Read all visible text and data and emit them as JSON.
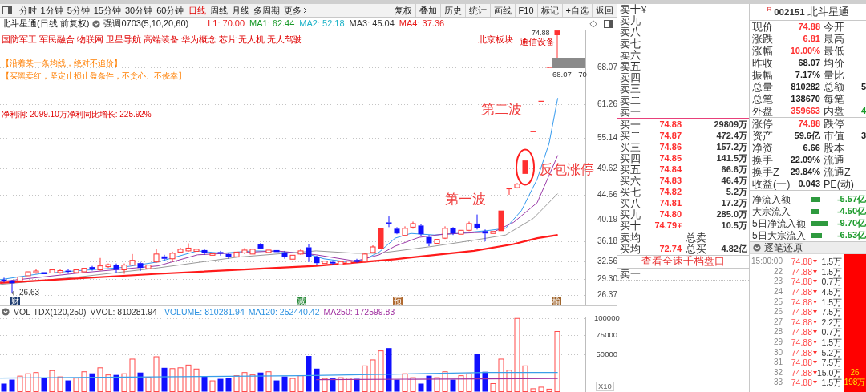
{
  "toolbar": {
    "period_tabs": [
      {
        "label": "分时",
        "kind": "period",
        "selected": false
      },
      {
        "label": "1分钟",
        "kind": "period",
        "selected": false
      },
      {
        "label": "5分钟",
        "kind": "period",
        "selected": false
      },
      {
        "label": "15分钟",
        "kind": "period",
        "selected": false
      },
      {
        "label": "30分钟",
        "kind": "period",
        "selected": false
      },
      {
        "label": "60分钟",
        "kind": "period",
        "selected": false
      },
      {
        "label": "日线",
        "kind": "period",
        "selected": true
      },
      {
        "label": "周线",
        "kind": "period",
        "selected": false
      },
      {
        "label": "月线",
        "kind": "period",
        "selected": false
      },
      {
        "label": "多周期",
        "kind": "period",
        "selected": false
      },
      {
        "label": "更多",
        "kind": "menu",
        "selected": false
      }
    ],
    "buttons": [
      "复权",
      "叠加",
      "历史",
      "统计",
      "画线",
      "F10",
      "标记",
      "+自选",
      "返回"
    ]
  },
  "chart": {
    "title": "北斗星通(日线 前复权)",
    "indicator": "强调0703(5,10,20,60)",
    "legend": [
      {
        "text": "L1: 70.00",
        "color": "#e81c1c"
      },
      {
        "text": "MA1: 62.44",
        "color": "#1a9a2a"
      },
      {
        "text": "MA2: 52.18",
        "color": "#20b4c8"
      },
      {
        "text": "MA3: 45.04",
        "color": "#333333"
      },
      {
        "text": "MA4: 37.36",
        "color": "#e81c1c"
      }
    ],
    "price_marker": "74.88",
    "concepts": "国防军工 军民融合 物联网 卫星导航 高端装备 华为概念 芯片 无人机 无人驾驶",
    "sector_tags": [
      "北京板块",
      "通信设备"
    ],
    "notes": [
      "【沿着某一条均线，绝对不追价】",
      "【买黑卖红；坚定止损止盈条件，不贪心、不侥幸】"
    ],
    "range_label": "68.07 - 70",
    "profit_note": "净利润: 2099.10万净利同比增长: 225.92%",
    "annotations": [
      "第二波",
      "反包涨停",
      "第一波"
    ],
    "low_label": "26.63",
    "y_axis": [
      "68.07",
      "61.26",
      "55.14",
      "49.62",
      "44.66",
      "40.19",
      "36.18",
      "32.56",
      "29.30",
      "26.37"
    ],
    "event_markers": [
      {
        "label": "财",
        "color": "#1f3d70"
      },
      {
        "label": "减",
        "color": "#2a8a3a"
      },
      {
        "label": "预",
        "color": "#b06a30"
      },
      {
        "label": "榆",
        "color": "#a0662e"
      }
    ]
  },
  "volume": {
    "title": "VOL-TDX(120,250)",
    "legend": [
      {
        "text": "VVOL: 810281.94",
        "color": "#333333"
      },
      {
        "text": "VOLUME: 810281.94",
        "color": "#2a90e0"
      },
      {
        "text": "MA120: 252440.42",
        "color": "#2a90e0"
      },
      {
        "text": "MA250: 172599.83",
        "color": "#a030a0"
      }
    ],
    "y_axis": [
      "100000",
      "75000",
      "50000"
    ],
    "scale_label": "X10"
  },
  "order_book": {
    "asks": [
      {
        "label": "卖十",
        "symbol": "¥"
      },
      {
        "label": "卖九"
      },
      {
        "label": "卖八"
      },
      {
        "label": "卖七"
      },
      {
        "label": "卖六"
      },
      {
        "label": "卖五"
      },
      {
        "label": "卖四"
      },
      {
        "label": "卖三"
      },
      {
        "label": "卖二"
      },
      {
        "label": "卖一"
      }
    ],
    "bids": [
      {
        "label": "买一",
        "price": "74.88",
        "volume": "29809万",
        "flag": false
      },
      {
        "label": "买二",
        "price": "74.87",
        "volume": "472.4万",
        "flag": false
      },
      {
        "label": "买三",
        "price": "74.86",
        "volume": "157.2万",
        "flag": false
      },
      {
        "label": "买四",
        "price": "74.85",
        "volume": "141.5万",
        "flag": false
      },
      {
        "label": "买五",
        "price": "74.84",
        "volume": "66.6万",
        "flag": false
      },
      {
        "label": "买六",
        "price": "74.83",
        "volume": "46.4万",
        "flag": false
      },
      {
        "label": "买七",
        "price": "74.82",
        "volume": "5.2万",
        "flag": false
      },
      {
        "label": "买八",
        "price": "74.81",
        "volume": "17.2万",
        "flag": false
      },
      {
        "label": "买九",
        "price": "74.80",
        "volume": "285.0万",
        "flag": false
      },
      {
        "label": "买十",
        "price": "74.79",
        "volume": "10.5万",
        "flag": true
      }
    ],
    "summary": [
      {
        "label": "卖均",
        "label2": "总卖"
      },
      {
        "label": "买均",
        "value": "72.74",
        "label2": "总买",
        "value2": "4.82亿"
      }
    ],
    "link": "查看全速千档盘口",
    "lower_asks": [
      "卖一"
    ]
  },
  "quote": {
    "badge": "R",
    "code": "002151",
    "name": "北斗星通",
    "rows": [
      {
        "cells": [
          {
            "label": "现价",
            "value": "74.88",
            "color": "#ff3030"
          },
          {
            "label": "今开"
          }
        ]
      },
      {
        "cells": [
          {
            "label": "涨跌",
            "value": "6.81",
            "color": "#ff3030"
          },
          {
            "label": "最高"
          }
        ]
      },
      {
        "cells": [
          {
            "label": "涨幅",
            "value": "10.00%",
            "color": "#ff3030"
          },
          {
            "label": "最低"
          }
        ]
      },
      {
        "cells": [
          {
            "label": "昨收",
            "value": "68.07",
            "color": "#222222"
          },
          {
            "label": "均价"
          }
        ]
      },
      {
        "cells": [
          {
            "label": "振幅",
            "value": "7.17%",
            "color": "#222222"
          },
          {
            "label": "量比"
          }
        ]
      },
      {
        "cells": [
          {
            "label": "总量",
            "value": "810282",
            "color": "#222222"
          },
          {
            "label": "总额",
            "value": "5",
            "color": "#222222"
          }
        ]
      },
      {
        "cells": [
          {
            "label": "总笔",
            "value": "138670",
            "color": "#222222"
          },
          {
            "label": "每笔"
          }
        ]
      },
      {
        "cells": [
          {
            "label": "外盘",
            "value": "359663",
            "color": "#ff3030"
          },
          {
            "label": "内盘",
            "value": "4",
            "color": "#1a9a2a"
          }
        ]
      }
    ],
    "limit_rows": [
      {
        "cells": [
          {
            "label": "涨停",
            "value": "74.88",
            "color": "#ff3030"
          },
          {
            "label": "跌停"
          }
        ]
      },
      {
        "cells": [
          {
            "label": "资产",
            "value": "59.6亿",
            "color": "#222222"
          },
          {
            "label": "市值",
            "value": "3",
            "color": "#222222"
          }
        ]
      },
      {
        "cells": [
          {
            "label": "净资",
            "value": "6.66",
            "color": "#222222"
          },
          {
            "label": "股本"
          }
        ]
      },
      {
        "cells": [
          {
            "label": "换手",
            "value": "22.09%",
            "color": "#222222"
          },
          {
            "label": "流通"
          }
        ]
      },
      {
        "cells": [
          {
            "label": "换手Z",
            "value": "29.84%",
            "color": "#222222"
          },
          {
            "label": "流通Z"
          }
        ]
      },
      {
        "cells": [
          {
            "label": "收益(一)",
            "value": "0.043",
            "color": "#222222"
          },
          {
            "label": "PE(动)"
          }
        ]
      }
    ],
    "fund_flow": [
      {
        "label": "净流入额",
        "value": "-5.57亿"
      },
      {
        "label": "大宗流入",
        "value": "-4.50亿"
      },
      {
        "label": "5日净流入额",
        "value": "-9.70亿"
      },
      {
        "label": "5日大宗流入",
        "value": "-6.53亿"
      }
    ],
    "ticks_title": "逐笔还原",
    "ticks": [
      {
        "time": "15:00:00",
        "price": "74.88",
        "down": true,
        "volume": "1.5万"
      },
      {
        "time": "22",
        "price": "74.88",
        "down": true,
        "volume": "1.5万"
      },
      {
        "time": "23",
        "price": "74.88",
        "down": true,
        "volume": "0.7万"
      },
      {
        "time": "24",
        "price": "74.88",
        "down": true,
        "volume": "4.5万"
      },
      {
        "time": "25",
        "price": "74.88",
        "down": true,
        "volume": "1.5万"
      },
      {
        "time": "26",
        "price": "74.88",
        "down": true,
        "volume": "7.5万"
      },
      {
        "time": "27",
        "price": "74.88",
        "down": true,
        "volume": "2.2万"
      },
      {
        "time": "28",
        "price": "74.88",
        "down": true,
        "volume": "0.7万"
      },
      {
        "time": "29",
        "price": "74.88",
        "down": true,
        "volume": "1.5万"
      },
      {
        "time": "30",
        "price": "74.88",
        "down": true,
        "volume": "5.2万"
      },
      {
        "time": "31",
        "price": "74.88",
        "down": true,
        "volume": "7.5万"
      },
      {
        "time": "32",
        "price": "74.88",
        "down": true,
        "volume": "15.0万"
      },
      {
        "time": "33",
        "price": "74.88",
        "down": true,
        "volume": "1.5万"
      }
    ],
    "side_block": [
      "26",
      "198万"
    ]
  }
}
